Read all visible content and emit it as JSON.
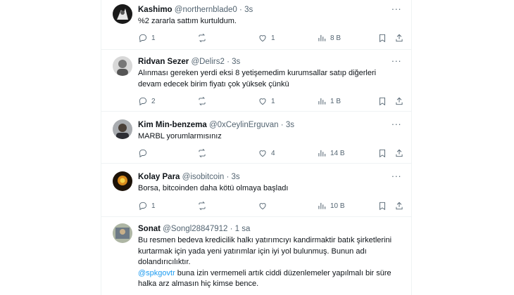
{
  "tweets": [
    {
      "name": "Kashimo",
      "handle": "@northernblade0",
      "time": "3s",
      "lines": [
        "%2 zararla sattım kurtuldum."
      ],
      "replies": "1",
      "retweets": "",
      "likes": "1",
      "views": "8 B",
      "avatar_color": "#1a1a1a"
    },
    {
      "name": "Ridvan Sezer",
      "handle": "@Delirs2",
      "time": "3s",
      "lines": [
        "Alınması gereken yerdi eksi 8 yetişemedim kurumsallar satıp diğerleri",
        "devam edecek birim fiyatı çok yüksek çünkü"
      ],
      "replies": "2",
      "retweets": "",
      "likes": "1",
      "views": "1 B",
      "avatar_color": "#c8c8c8"
    },
    {
      "name": "Kim Min-benzema",
      "handle": "@0xCeylinErguvan",
      "time": "3s",
      "lines": [
        "MARBL yorumlarmısınız"
      ],
      "replies": "",
      "retweets": "",
      "likes": "4",
      "views": "14 B",
      "avatar_color": "#8f9296"
    },
    {
      "name": "Kolay Para",
      "handle": "@isobitcoin",
      "time": "3s",
      "lines": [
        "Borsa, bitcoinden daha kötü olmaya başladı"
      ],
      "replies": "1",
      "retweets": "",
      "likes": "",
      "views": "10 B",
      "avatar_color": "#2a1a0a"
    },
    {
      "name": "Sonat",
      "handle": "@Songl28847912",
      "time": "1 sa",
      "lines": [
        "Bu resmen bedeva kredicilik halkı yatırımcıyı kandirmaktir batık şirketlerini",
        "kurtarmak için yada yeni yatırımlar için iyi yol bulunmuş. Bunun adı",
        "dolandırıcılıktır."
      ],
      "mention": "@spkgovtr",
      "mention_rest": " buna izin vermemeli artık ciddi düzenlemeler yapılmalı bir süre",
      "last_line": "halka arz almasın hiç kimse bence.",
      "avatar_color": "#b0b8a8"
    }
  ],
  "ui": {
    "dot": "·",
    "more": "···"
  }
}
